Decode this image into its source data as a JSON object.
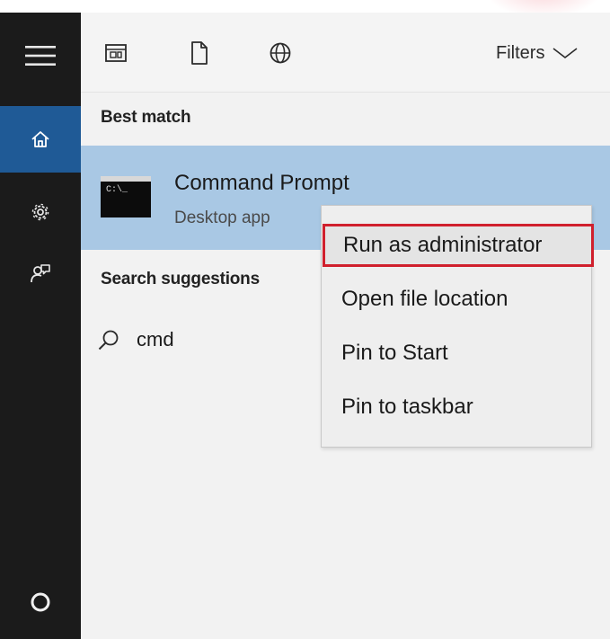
{
  "sidebar": {
    "items": [
      {
        "icon": "hamburger-menu-icon"
      },
      {
        "icon": "home-icon",
        "selected": true
      },
      {
        "icon": "gear-icon"
      },
      {
        "icon": "feedback-icon"
      },
      {
        "icon": "cortana-circle-icon"
      }
    ],
    "selected_color": "#1f5a96"
  },
  "toolbar": {
    "icons": [
      "apps-filter-icon",
      "documents-filter-icon",
      "web-filter-icon"
    ],
    "filters_label": "Filters"
  },
  "results": {
    "best_match_label": "Best match",
    "best_match": {
      "title": "Command Prompt",
      "subtitle": "Desktop app",
      "icon_text": "C:\\_",
      "highlight_color": "#a9c8e4"
    },
    "suggestions_label": "Search suggestions",
    "suggestions": [
      {
        "text": "cmd",
        "icon": "search-icon"
      }
    ]
  },
  "context_menu": {
    "items": [
      {
        "label": "Run as administrator",
        "highlighted": true
      },
      {
        "label": "Open file location"
      },
      {
        "label": "Pin to Start"
      },
      {
        "label": "Pin to taskbar"
      }
    ],
    "highlight_border_color": "#d0202d"
  }
}
